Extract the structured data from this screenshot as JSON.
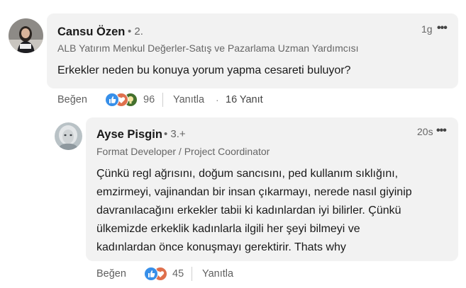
{
  "comment": {
    "author": "Cansu Özen",
    "degree": "• 2.",
    "headline": "ALB Yatırım Menkul Değerler-Satış ve Pazarlama Uzman Yardımcısı",
    "time": "1g",
    "more": "•••",
    "text": "Erkekler neden bu konuya yorum yapma cesareti buluyor?",
    "like_label": "Beğen",
    "reaction_count": "96",
    "reply_label": "Yanıtla",
    "separator": "·",
    "replies_label": "16 Yanıt",
    "reactions": [
      "like-icon",
      "love-icon",
      "insightful-icon"
    ]
  },
  "reply": {
    "author": "Ayse Pisgin",
    "degree": "• 3.+",
    "headline": "Format Developer / Project Coordinator",
    "time": "20s",
    "more": "•••",
    "text_lines": [
      "Çünkü regl ağrısını, doğum sancısını, ped kullanım sıklığını,",
      "emzirmeyi, vajinandan bir insan çıkarmayı, nerede nasıl giyinip",
      "davranılacağını erkekler tabii ki kadınlardan iyi bilirler. Çünkü",
      "ülkemizde erkeklik kadınlarla ilgili her şeyi bilmeyi ve",
      "kadınlardan önce konuşmayı gerektirir. Thats why"
    ],
    "like_label": "Beğen",
    "reaction_count": "45",
    "reply_label": "Yanıtla",
    "reactions": [
      "like-icon",
      "love-icon"
    ]
  },
  "colors": {
    "bubble": "#f2f2f2",
    "like": "#378fe9",
    "love": "#df704d",
    "insightful": "#44712e"
  }
}
